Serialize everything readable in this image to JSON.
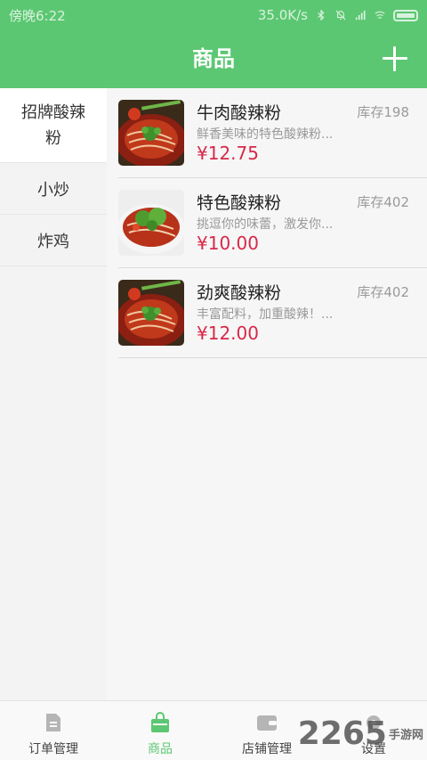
{
  "status_bar": {
    "time": "傍晚6:22",
    "speed": "35.0K/s"
  },
  "header": {
    "title": "商品"
  },
  "sidebar": {
    "categories": [
      {
        "label": "招牌酸辣粉"
      },
      {
        "label": "小炒"
      },
      {
        "label": "炸鸡"
      }
    ]
  },
  "products": [
    {
      "name": "牛肉酸辣粉",
      "stock": "库存198",
      "desc": "鲜香美味的特色酸辣粉...",
      "price": "¥12.75"
    },
    {
      "name": "特色酸辣粉",
      "stock": "库存402",
      "desc": "挑逗你的味蕾，激发你...",
      "price": "¥10.00"
    },
    {
      "name": "劲爽酸辣粉",
      "stock": "库存402",
      "desc": "丰富配料，加重酸辣！...",
      "price": "¥12.00"
    }
  ],
  "tabbar": {
    "tabs": [
      {
        "label": "订单管理",
        "icon": "document-icon"
      },
      {
        "label": "商品",
        "icon": "bag-icon"
      },
      {
        "label": "店铺管理",
        "icon": "wallet-icon"
      },
      {
        "label": "设置",
        "icon": "gear-icon"
      }
    ]
  },
  "watermark": {
    "text": "2265",
    "sub": "手游网"
  },
  "colors": {
    "brand": "#5cc772",
    "price": "#d8284a"
  }
}
